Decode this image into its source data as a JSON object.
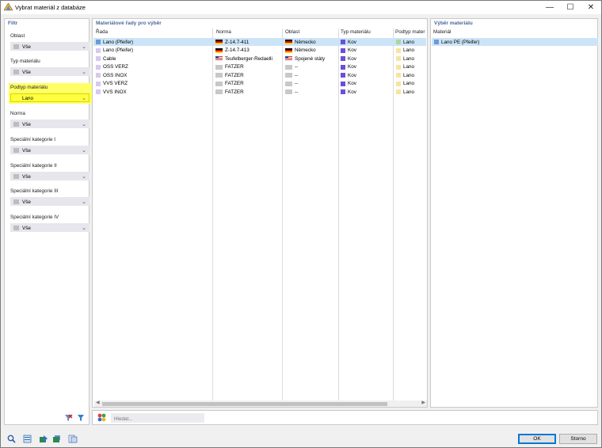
{
  "window": {
    "title": "Vybrat materiál z databáze",
    "minimize_icon": "minimize-icon",
    "maximize_icon": "maximize-icon",
    "close_icon": "close-icon"
  },
  "filter": {
    "title": "Filtr",
    "fields": [
      {
        "label": "Oblast",
        "value": "Vše"
      },
      {
        "label": "Typ materiálu",
        "value": "Vše"
      },
      {
        "label": "Podtyp materiálu",
        "value": "Lano"
      },
      {
        "label": "Norma",
        "value": "Vše"
      },
      {
        "label": "Speciální kategorie I",
        "value": "Vše"
      },
      {
        "label": "Speciální kategorie II",
        "value": "Vše"
      },
      {
        "label": "Speciální kategorie III",
        "value": "Vše"
      },
      {
        "label": "Speciální kategorie IV",
        "value": "Vše"
      }
    ],
    "highlight_color": "#ffff40"
  },
  "series": {
    "title": "Materiálové řady pro výběr",
    "columns": [
      "Řada",
      "Norma",
      "Oblast",
      "Typ materiálu",
      "Podtyp mater"
    ],
    "rows": [
      {
        "rada": "Lano (Pfeifer)",
        "rada_color": "#6a9ad8",
        "norma": "Z-14.7-411",
        "norma_flag": "de",
        "oblast": "Německo",
        "oblast_flag": "de",
        "typ": "Kov",
        "typ_color": "#6b4fd8",
        "podtyp": "Lano",
        "podtyp_color": "#a8d8a0",
        "selected": true
      },
      {
        "rada": "Lano (Pfeifer)",
        "rada_color": "#d8c8f0",
        "norma": "Z-14.7-413",
        "norma_flag": "de",
        "oblast": "Německo",
        "oblast_flag": "de",
        "typ": "Kov",
        "typ_color": "#6b4fd8",
        "podtyp": "Lano",
        "podtyp_color": "#f8e4a0",
        "selected": false
      },
      {
        "rada": "Cable",
        "rada_color": "#d8c8f0",
        "norma": "Teufelberger-Redaelli",
        "norma_flag": "us",
        "oblast": "Spojené státy",
        "oblast_flag": "us",
        "typ": "Kov",
        "typ_color": "#6b4fd8",
        "podtyp": "Lano",
        "podtyp_color": "#f8e4a0",
        "selected": false
      },
      {
        "rada": "OSS VERZ",
        "rada_color": "#d8c8f0",
        "norma": "FATZER",
        "norma_flag": "none",
        "oblast": "--",
        "oblast_flag": "none",
        "typ": "Kov",
        "typ_color": "#6b4fd8",
        "podtyp": "Lano",
        "podtyp_color": "#f8e4a0",
        "selected": false
      },
      {
        "rada": "OSS INOX",
        "rada_color": "#d8c8f0",
        "norma": "FATZER",
        "norma_flag": "none",
        "oblast": "--",
        "oblast_flag": "none",
        "typ": "Kov",
        "typ_color": "#6b4fd8",
        "podtyp": "Lano",
        "podtyp_color": "#f8e4a0",
        "selected": false
      },
      {
        "rada": "VVS VERZ",
        "rada_color": "#d8c8f0",
        "norma": "FATZER",
        "norma_flag": "none",
        "oblast": "--",
        "oblast_flag": "none",
        "typ": "Kov",
        "typ_color": "#6b4fd8",
        "podtyp": "Lano",
        "podtyp_color": "#f8e4a0",
        "selected": false
      },
      {
        "rada": "VVS INOX",
        "rada_color": "#d8c8f0",
        "norma": "FATZER",
        "norma_flag": "none",
        "oblast": "--",
        "oblast_flag": "none",
        "typ": "Kov",
        "typ_color": "#6b4fd8",
        "podtyp": "Lano",
        "podtyp_color": "#f8e4a0",
        "selected": false
      }
    ]
  },
  "selection": {
    "title": "Výběr materiálu",
    "column": "Materiál",
    "items": [
      {
        "label": "Lano PE (Pfeifer)",
        "color": "#6a9ad8"
      }
    ]
  },
  "search": {
    "placeholder": "Hledat..."
  },
  "buttons": {
    "ok": "OK",
    "cancel": "Storno"
  },
  "accent": "#0078d7"
}
